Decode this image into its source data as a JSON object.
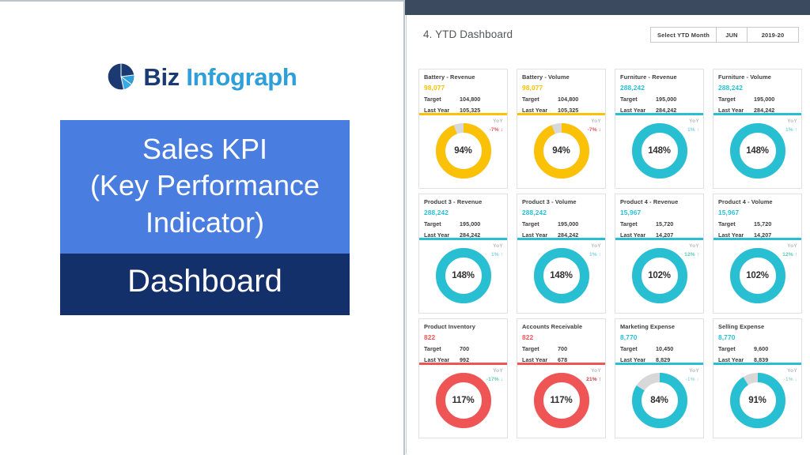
{
  "brand": {
    "logo_icon": "pie-chart-icon",
    "name_part1": "Biz",
    "name_part2": "Infograph",
    "color_dark": "#1b3a72",
    "color_light": "#2e9fd8"
  },
  "title_card": {
    "upper_lines": [
      "Sales KPI",
      "(Key Performance",
      "Indicator)"
    ],
    "lower_line": "Dashboard",
    "upper_bg": "#4a7de0",
    "lower_bg": "#14306b"
  },
  "dashboard": {
    "heading": "4. YTD Dashboard",
    "selector": {
      "label": "Select YTD Month",
      "month": "JUN",
      "year": "2019-20"
    }
  },
  "colors": {
    "yellow": "#fbc107",
    "teal": "#29bfd3",
    "red": "#f05555",
    "track": "#d8d8d8",
    "yoy_down_red": "#e0545c",
    "yoy_up_teal": "#5ec9b5",
    "yoy_up_red": "#c2403f",
    "yoy_down_gray_teal": "#9fd7d8"
  },
  "cards": [
    {
      "title": "Battery - Revenue",
      "value": "98,077",
      "target_label": "Target",
      "target_value": "104,800",
      "lastyear_label": "Last Year",
      "lastyear_value": "105,325",
      "yoy_label": "YoY",
      "yoy_value": "-7% ↓",
      "yoy_color": "#e0545c",
      "percent_text": "94%",
      "percent": 94,
      "accent": "#fbc107",
      "ring": "#fbc107"
    },
    {
      "title": "Battery - Volume",
      "value": "98,077",
      "target_label": "Target",
      "target_value": "104,800",
      "lastyear_label": "Last Year",
      "lastyear_value": "105,325",
      "yoy_label": "YoY",
      "yoy_value": "-7% ↓",
      "yoy_color": "#e0545c",
      "percent_text": "94%",
      "percent": 94,
      "accent": "#fbc107",
      "ring": "#fbc107"
    },
    {
      "title": "Furniture - Revenue",
      "value": "288,242",
      "target_label": "Target",
      "target_value": "195,000",
      "lastyear_label": "Last Year",
      "lastyear_value": "284,242",
      "yoy_label": "YoY",
      "yoy_value": "1% ↑",
      "yoy_color": "#7fd4d9",
      "percent_text": "148%",
      "percent": 100,
      "accent": "#29bfd3",
      "ring": "#29bfd3"
    },
    {
      "title": "Furniture - Volume",
      "value": "288,242",
      "target_label": "Target",
      "target_value": "195,000",
      "lastyear_label": "Last Year",
      "lastyear_value": "284,242",
      "yoy_label": "YoY",
      "yoy_value": "1% ↑",
      "yoy_color": "#7fd4d9",
      "percent_text": "148%",
      "percent": 100,
      "accent": "#29bfd3",
      "ring": "#29bfd3"
    },
    {
      "title": "Product 3 - Revenue",
      "value": "288,242",
      "target_label": "Target",
      "target_value": "195,000",
      "lastyear_label": "Last Year",
      "lastyear_value": "284,242",
      "yoy_label": "YoY",
      "yoy_value": "1% ↑",
      "yoy_color": "#7fd4d9",
      "percent_text": "148%",
      "percent": 100,
      "accent": "#29bfd3",
      "ring": "#29bfd3"
    },
    {
      "title": "Product 3 - Volume",
      "value": "288,242",
      "target_label": "Target",
      "target_value": "195,000",
      "lastyear_label": "Last Year",
      "lastyear_value": "284,242",
      "yoy_label": "YoY",
      "yoy_value": "1% ↑",
      "yoy_color": "#7fd4d9",
      "percent_text": "148%",
      "percent": 100,
      "accent": "#29bfd3",
      "ring": "#29bfd3"
    },
    {
      "title": "Product 4 - Revenue",
      "value": "15,967",
      "target_label": "Target",
      "target_value": "15,720",
      "lastyear_label": "Last Year",
      "lastyear_value": "14,207",
      "yoy_label": "YoY",
      "yoy_value": "12% ↑",
      "yoy_color": "#5ec9b5",
      "percent_text": "102%",
      "percent": 100,
      "accent": "#29bfd3",
      "ring": "#29bfd3"
    },
    {
      "title": "Product 4 - Volume",
      "value": "15,967",
      "target_label": "Target",
      "target_value": "15,720",
      "lastyear_label": "Last Year",
      "lastyear_value": "14,207",
      "yoy_label": "YoY",
      "yoy_value": "12% ↑",
      "yoy_color": "#5ec9b5",
      "percent_text": "102%",
      "percent": 100,
      "accent": "#29bfd3",
      "ring": "#29bfd3"
    },
    {
      "title": "Product Inventory",
      "value": "822",
      "target_label": "Target",
      "target_value": "700",
      "lastyear_label": "Last Year",
      "lastyear_value": "992",
      "yoy_label": "YoY",
      "yoy_value": "-17% ↓",
      "yoy_color": "#5ec9b5",
      "percent_text": "117%",
      "percent": 100,
      "accent": "#f05555",
      "ring": "#f05555"
    },
    {
      "title": "Accounts Receivable",
      "value": "822",
      "target_label": "Target",
      "target_value": "700",
      "lastyear_label": "Last Year",
      "lastyear_value": "678",
      "yoy_label": "YoY",
      "yoy_value": "21% ↑",
      "yoy_color": "#c2403f",
      "percent_text": "117%",
      "percent": 100,
      "accent": "#f05555",
      "ring": "#f05555"
    },
    {
      "title": "Marketing Expense",
      "value": "8,770",
      "target_label": "Target",
      "target_value": "10,450",
      "lastyear_label": "Last Year",
      "lastyear_value": "8,829",
      "yoy_label": "YoY",
      "yoy_value": "-1% ↓",
      "yoy_color": "#9fd7d8",
      "percent_text": "84%",
      "percent": 84,
      "accent": "#29bfd3",
      "ring": "#29bfd3"
    },
    {
      "title": "Selling Expense",
      "value": "8,770",
      "target_label": "Target",
      "target_value": "9,600",
      "lastyear_label": "Last Year",
      "lastyear_value": "8,839",
      "yoy_label": "YoY",
      "yoy_value": "-1% ↓",
      "yoy_color": "#9fd7d8",
      "percent_text": "91%",
      "percent": 91,
      "accent": "#29bfd3",
      "ring": "#29bfd3"
    }
  ]
}
